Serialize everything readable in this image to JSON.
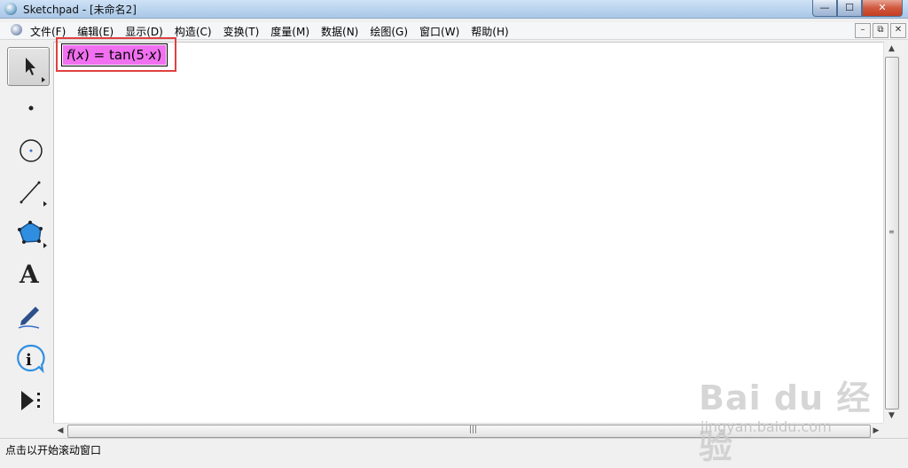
{
  "window": {
    "title": "Sketchpad  - [未命名2]",
    "minimize": "—",
    "maximize": "☐",
    "close": "✕"
  },
  "menubar": {
    "items": [
      "文件(F)",
      "编辑(E)",
      "显示(D)",
      "构造(C)",
      "变换(T)",
      "度量(M)",
      "数据(N)",
      "绘图(G)",
      "窗口(W)",
      "帮助(H)"
    ],
    "doc_minimize": "–",
    "doc_restore": "⧉",
    "doc_close": "✕"
  },
  "toolbox": {
    "tools": [
      "arrow-select-tool",
      "point-tool",
      "compass-tool",
      "straightedge-tool",
      "polygon-tool",
      "text-tool",
      "marker-tool",
      "information-tool",
      "custom-tool"
    ],
    "selected": "arrow-select-tool",
    "text_tool_glyph": "A"
  },
  "canvas": {
    "function_label": {
      "fname": "f",
      "open": "(",
      "var": "x",
      "close": ")",
      "rest": " = tan(5·",
      "var2": "x",
      "end": ")"
    },
    "highlight_color": "#e04040",
    "label_fill": "#f070f0"
  },
  "statusbar": {
    "text": "点击以开始滚动窗口"
  },
  "watermark": {
    "brand": "Bai du 经验",
    "url": "jingyan.baidu.com"
  }
}
